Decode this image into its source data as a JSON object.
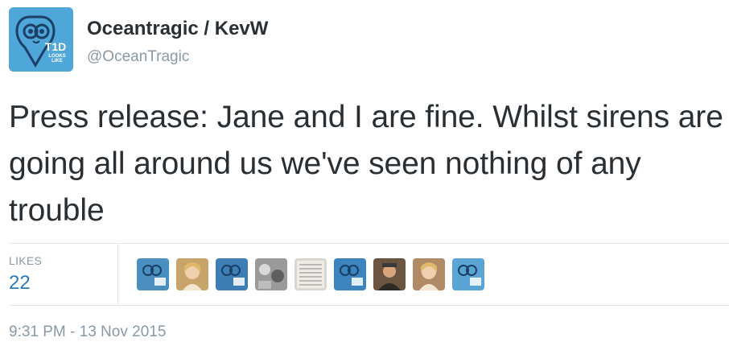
{
  "user": {
    "display_name": "Oceantragic / KevW",
    "screen_name": "@OceanTragic",
    "avatar_icon": "t1d-looks-like-logo-icon",
    "avatar_badge_line1": "T1D",
    "avatar_badge_line2": "LOOKS",
    "avatar_badge_line3": "LIKE",
    "avatar_color": "#4fa6d8"
  },
  "tweet": {
    "text": "Press release: Jane and I are fine. Whilst sirens are going all around us we've seen nothing of any trouble"
  },
  "stats": {
    "likes_label": "LIKES",
    "likes_count": "22",
    "count_color": "#2b7bb9"
  },
  "likers": [
    {
      "icon": "t1d-logo-avatar",
      "color": "#4a8fc0"
    },
    {
      "icon": "woman-photo-avatar",
      "color": "#c9a46a"
    },
    {
      "icon": "t1d-logo-avatar",
      "color": "#3d7fb5"
    },
    {
      "icon": "greyscale-photo-avatar",
      "color": "#9a9a9a"
    },
    {
      "icon": "handwritten-note-avatar",
      "color": "#d8d6cf"
    },
    {
      "icon": "t1d-logo-avatar",
      "color": "#3b84bd"
    },
    {
      "icon": "person-photo-avatar",
      "color": "#6b5440"
    },
    {
      "icon": "woman-photo-avatar",
      "color": "#b08a64"
    },
    {
      "icon": "t1d-logo-avatar",
      "color": "#5aa5d6"
    }
  ],
  "timestamp": "9:31 PM - 13 Nov 2015"
}
